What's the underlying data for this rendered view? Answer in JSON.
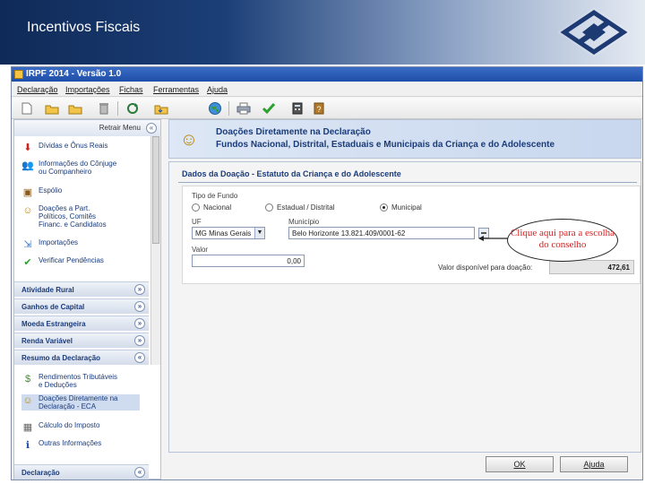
{
  "slide": {
    "title": "Incentivos Fiscais",
    "logo": "receita-federal-logo"
  },
  "window": {
    "title": "IRPF 2014 - Versão 1.0"
  },
  "menu": [
    "Declaração",
    "Importações",
    "Fichas",
    "Ferramentas",
    "Ajuda"
  ],
  "toolbar": {
    "icons": [
      "new-file-icon",
      "open-folder-icon",
      "folder-icon",
      "trash-icon",
      "refresh-icon",
      "save-folder-icon",
      "globe-icon",
      "print-icon",
      "check-icon",
      "calculator-icon",
      "help-book-icon"
    ]
  },
  "sidebar": {
    "retrair": "Retrair Menu",
    "items": [
      {
        "label": "Dívidas e Ônus Reais",
        "icon": "debt-arrow-icon"
      },
      {
        "label": "Informações do Cônjuge\nou Companheiro",
        "icon": "spouse-icon"
      },
      {
        "label": "Espólio",
        "icon": "chest-icon"
      },
      {
        "label": "Doações a Part.\nPolíticos, Comitês\nFinanc. e Candidatos",
        "icon": "donation-icon"
      },
      {
        "label": "Importações",
        "icon": "import-icon"
      },
      {
        "label": "Verificar Pendências",
        "icon": "check-icon"
      }
    ],
    "sections": [
      "Atividade Rural",
      "Ganhos de Capital",
      "Moeda Estrangeira",
      "Renda Variável",
      "Resumo da Declaração"
    ],
    "resumo_items": [
      {
        "label": "Rendimentos Tributáveis\ne Deduções",
        "icon": "money-icon"
      },
      {
        "label": "Doações Diretamente na\nDeclaração - ECA",
        "icon": "people-icon"
      },
      {
        "label": "Cálculo do Imposto",
        "icon": "calc-icon"
      },
      {
        "label": "Outras Informações",
        "icon": "info-icon"
      }
    ],
    "bottom_section": "Declaração"
  },
  "main": {
    "header_line1": "Doações Diretamente na Declaração",
    "header_line2": "Fundos Nacional, Distrital, Estaduais e Municipais da Criança e do Adolescente",
    "content_title": "Dados da Doação - Estatuto da Criança e do Adolescente",
    "tipo_fundo_label": "Tipo de Fundo",
    "radios": [
      {
        "label": "Nacional",
        "selected": false
      },
      {
        "label": "Estadual / Distrital",
        "selected": false
      },
      {
        "label": "Municipal",
        "selected": true
      }
    ],
    "uf_label": "UF",
    "uf_value": "MG   Minas Gerais",
    "municipio_label": "Município",
    "municipio_value": "Belo Horizonte   13.821.409/0001-62",
    "valor_label": "Valor",
    "valor_value": "0,00",
    "valor_disponivel_label": "Valor disponível para doação:",
    "valor_disponivel": "472,61",
    "ok_label": "OK",
    "ajuda_label": "Ajuda"
  },
  "callout": {
    "text": "Clique aqui para a escolha do conselho"
  }
}
